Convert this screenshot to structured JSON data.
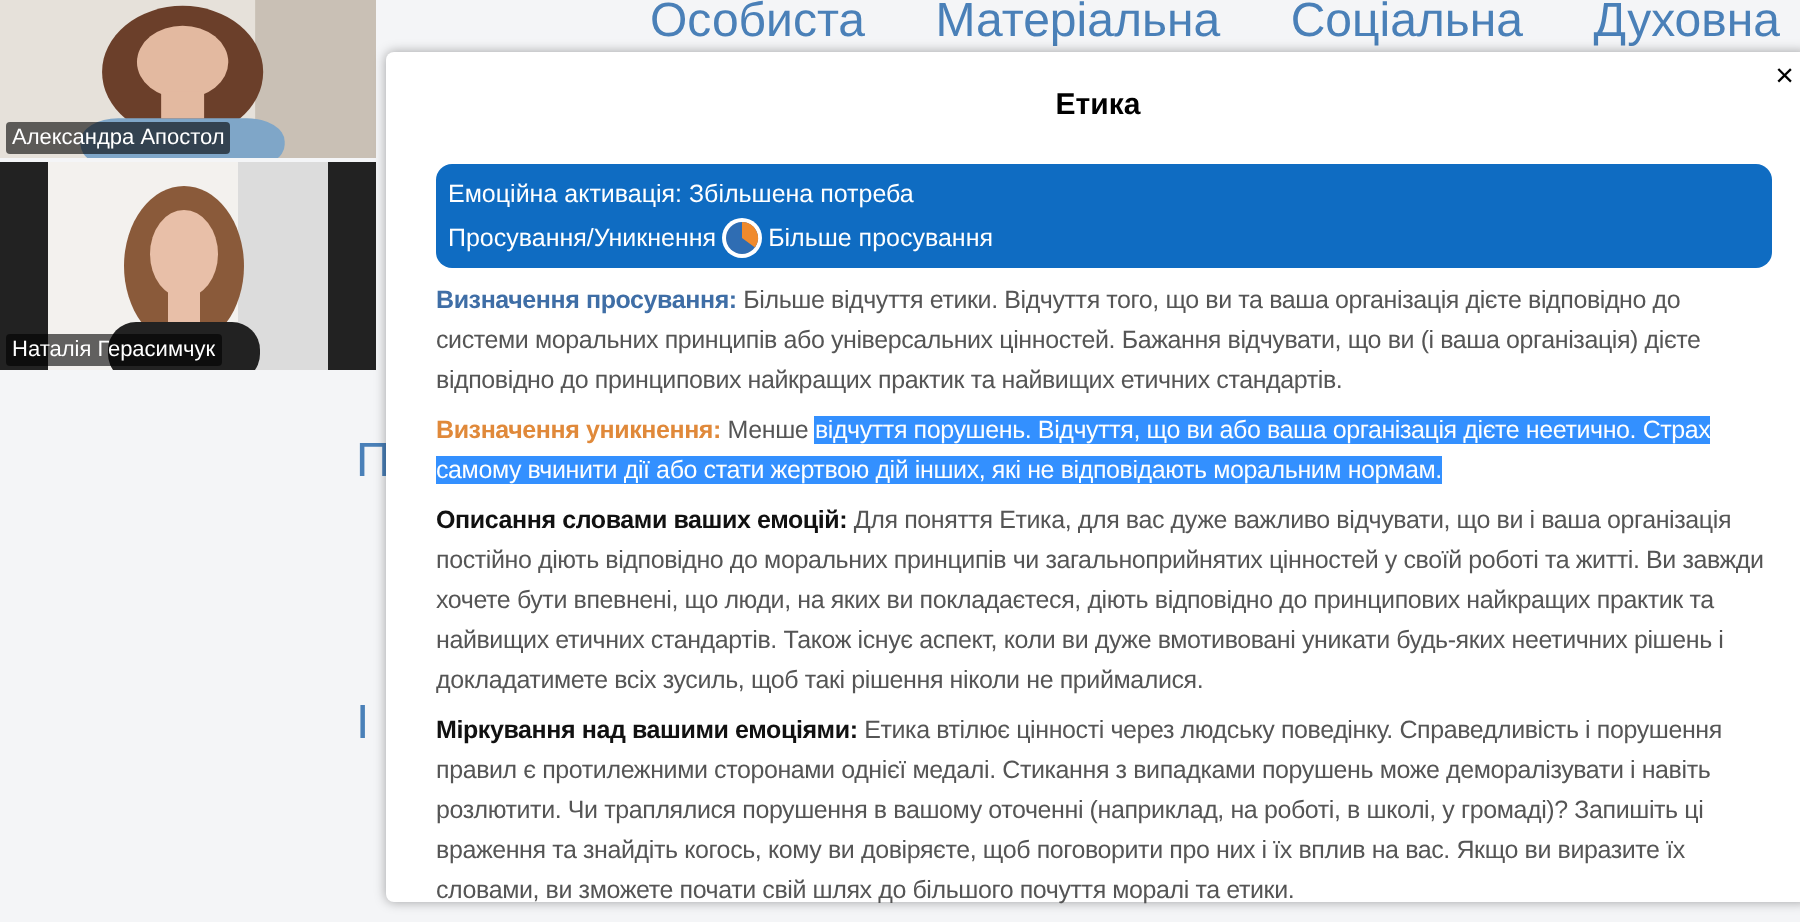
{
  "background_headings": [
    "Особиста",
    "Матеріальна",
    "Соціальна",
    "Духовна"
  ],
  "background_fragments": [
    "П",
    "І"
  ],
  "participants": [
    {
      "name": "Александра Апостол"
    },
    {
      "name": "Наталія Герасимчук"
    }
  ],
  "dialog": {
    "title": "Етика",
    "close": "×",
    "summary": {
      "line_1": "Емоційна активація: Збільшена потреба",
      "label": "Просування/Уникнення",
      "value": "Більше просування"
    },
    "paragraphs": [
      {
        "kind": "promotion",
        "label": "Визначення просування:",
        "text": " Більше відчуття етики. Відчуття того, що ви та ваша організація дієте відповідно до системи моральних принципів або універсальних цінностей. Бажання відчувати, що ви (і ваша організація) дієте відповідно до принципових найкращих практик та найвищих етичних стандартів."
      },
      {
        "kind": "avoidance",
        "label": "Визначення уникнення:",
        "text": " Менше ",
        "selected_text": "відчуття порушень. Відчуття, що ви або ваша організація дієте неетично. Страх самому вчинити дії або стати жертвою дій інших, які не відповідають моральним нормам."
      },
      {
        "kind": "plain",
        "label": "Описання словами ваших емоцій:",
        "text": " Для поняття Етика, для вас дуже важливо відчувати, що ви і ваша організація постійно діють відповідно до моральних принципів чи загальноприйнятих цінностей у своїй роботі та житті. Ви завжди хочете бути впевнені, що люди, на яких ви покладаєтеся, діють відповідно до принципових найкращих практик та найвищих етичних стандартів. Також існує аспект, коли ви дуже вмотивовані уникати будь-яких неетичних рішень і докладатимете всіх зусиль, щоб такі рішення ніколи не приймалися."
      },
      {
        "kind": "plain",
        "label": "Міркування над вашими емоціями:",
        "text": " Етика втілює цінності через людську поведінку. Справедливість і порушення правил є протилежними сторонами однієї медалі. Стикання з випадками порушень може деморалізувати і навіть розлютити. Чи траплялися порушення в вашому оточенні (наприклад, на роботі, в школі, у громаді)? Запишіть ці враження та знайдіть когось, кому ви довіряєте, щоб поговорити про них і їх вплив на вас. Якщо ви виразите їх словами, ви зможете почати свій шлях до більшого почуття моралі та етики."
      }
    ]
  }
}
